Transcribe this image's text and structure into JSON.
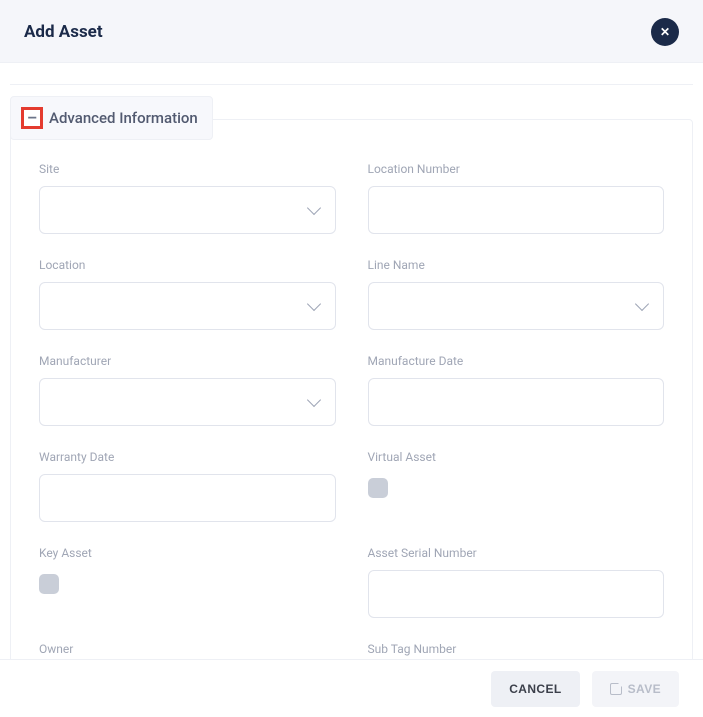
{
  "header": {
    "title": "Add Asset"
  },
  "panel": {
    "title": "Advanced Information",
    "collapse_symbol": "–"
  },
  "fields": {
    "site": {
      "label": "Site",
      "value": ""
    },
    "location_number": {
      "label": "Location Number",
      "value": ""
    },
    "location": {
      "label": "Location",
      "value": ""
    },
    "line_name": {
      "label": "Line Name",
      "value": ""
    },
    "manufacturer": {
      "label": "Manufacturer",
      "value": ""
    },
    "manufacture_date": {
      "label": "Manufacture Date",
      "value": ""
    },
    "warranty_date": {
      "label": "Warranty Date",
      "value": ""
    },
    "virtual_asset": {
      "label": "Virtual Asset",
      "checked": false
    },
    "key_asset": {
      "label": "Key Asset",
      "checked": false
    },
    "asset_serial_number": {
      "label": "Asset Serial Number",
      "value": ""
    },
    "owner": {
      "label": "Owner",
      "value": ""
    },
    "sub_tag_number": {
      "label": "Sub Tag Number",
      "value": ""
    }
  },
  "footer": {
    "cancel": "CANCEL",
    "save": "SAVE"
  }
}
